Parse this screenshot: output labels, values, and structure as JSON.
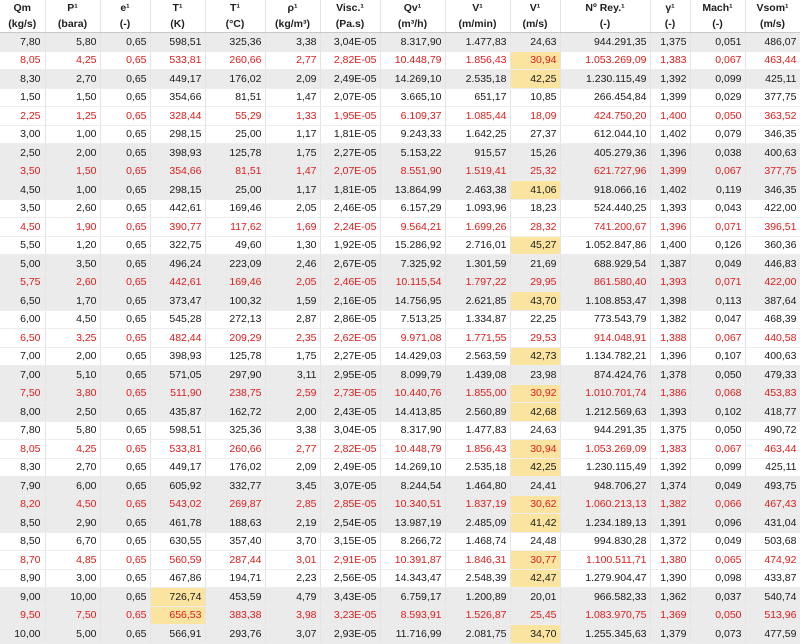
{
  "header": {
    "names": [
      "Qm",
      "P¹",
      "e¹",
      "T¹",
      "T¹",
      "ρ¹",
      "Visc.¹",
      "Qv¹",
      "V¹",
      "V¹",
      "Nº Rey.¹",
      "γ¹",
      "Mach¹",
      "Vsom¹"
    ],
    "units": [
      "(kg/s)",
      "(bara)",
      "(-)",
      "(K)",
      "(°C)",
      "(kg/m³)",
      "(Pa.s)",
      "(m³/h)",
      "(m/min)",
      "(m/s)",
      "(-)",
      "(-)",
      "(-)",
      "(m/s)"
    ]
  },
  "style": {
    "red_text": "#e01b1b",
    "black_text": "#1a1a1a",
    "band_grey": "#ebebeb",
    "highlight_yellow": "#fbe4a0"
  },
  "rows": [
    {
      "c": [
        "7,80",
        "5,80",
        "0,65",
        "598,51",
        "325,36",
        "3,38",
        "3,04E-05",
        "8.317,90",
        "1.477,83",
        "24,63",
        "944.291,35",
        "1,375",
        "0,051",
        "486,07"
      ],
      "red": false,
      "shade": true,
      "mark": []
    },
    {
      "c": [
        "8,05",
        "4,25",
        "0,65",
        "533,81",
        "260,66",
        "2,77",
        "2,82E-05",
        "10.448,79",
        "1.856,43",
        "30,94",
        "1.053.269,09",
        "1,383",
        "0,067",
        "463,44"
      ],
      "red": true,
      "shade": false,
      "mark": [
        9
      ]
    },
    {
      "c": [
        "8,30",
        "2,70",
        "0,65",
        "449,17",
        "176,02",
        "2,09",
        "2,49E-05",
        "14.269,10",
        "2.535,18",
        "42,25",
        "1.230.115,49",
        "1,392",
        "0,099",
        "425,11"
      ],
      "red": false,
      "shade": true,
      "mark": [
        9
      ]
    },
    {
      "c": [
        "1,50",
        "1,50",
        "0,65",
        "354,66",
        "81,51",
        "1,47",
        "2,07E-05",
        "3.665,10",
        "651,17",
        "10,85",
        "266.454,84",
        "1,399",
        "0,029",
        "377,75"
      ],
      "red": false,
      "shade": false,
      "mark": []
    },
    {
      "c": [
        "2,25",
        "1,25",
        "0,65",
        "328,44",
        "55,29",
        "1,33",
        "1,95E-05",
        "6.109,37",
        "1.085,44",
        "18,09",
        "424.750,20",
        "1,400",
        "0,050",
        "363,52"
      ],
      "red": true,
      "shade": false,
      "mark": []
    },
    {
      "c": [
        "3,00",
        "1,00",
        "0,65",
        "298,15",
        "25,00",
        "1,17",
        "1,81E-05",
        "9.243,33",
        "1.642,25",
        "27,37",
        "612.044,10",
        "1,402",
        "0,079",
        "346,35"
      ],
      "red": false,
      "shade": false,
      "mark": []
    },
    {
      "c": [
        "2,50",
        "2,00",
        "0,65",
        "398,93",
        "125,78",
        "1,75",
        "2,27E-05",
        "5.153,22",
        "915,57",
        "15,26",
        "405.279,36",
        "1,396",
        "0,038",
        "400,63"
      ],
      "red": false,
      "shade": true,
      "mark": []
    },
    {
      "c": [
        "3,50",
        "1,50",
        "0,65",
        "354,66",
        "81,51",
        "1,47",
        "2,07E-05",
        "8.551,90",
        "1.519,41",
        "25,32",
        "621.727,96",
        "1,399",
        "0,067",
        "377,75"
      ],
      "red": true,
      "shade": true,
      "mark": []
    },
    {
      "c": [
        "4,50",
        "1,00",
        "0,65",
        "298,15",
        "25,00",
        "1,17",
        "1,81E-05",
        "13.864,99",
        "2.463,38",
        "41,06",
        "918.066,16",
        "1,402",
        "0,119",
        "346,35"
      ],
      "red": false,
      "shade": true,
      "mark": [
        9
      ]
    },
    {
      "c": [
        "3,50",
        "2,60",
        "0,65",
        "442,61",
        "169,46",
        "2,05",
        "2,46E-05",
        "6.157,29",
        "1.093,96",
        "18,23",
        "524.440,25",
        "1,393",
        "0,043",
        "422,00"
      ],
      "red": false,
      "shade": false,
      "mark": []
    },
    {
      "c": [
        "4,50",
        "1,90",
        "0,65",
        "390,77",
        "117,62",
        "1,69",
        "2,24E-05",
        "9.564,21",
        "1.699,26",
        "28,32",
        "741.200,67",
        "1,396",
        "0,071",
        "396,51"
      ],
      "red": true,
      "shade": false,
      "mark": []
    },
    {
      "c": [
        "5,50",
        "1,20",
        "0,65",
        "322,75",
        "49,60",
        "1,30",
        "1,92E-05",
        "15.286,92",
        "2.716,01",
        "45,27",
        "1.052.847,86",
        "1,400",
        "0,126",
        "360,36"
      ],
      "red": false,
      "shade": false,
      "mark": [
        9
      ]
    },
    {
      "c": [
        "5,00",
        "3,50",
        "0,65",
        "496,24",
        "223,09",
        "2,46",
        "2,67E-05",
        "7.325,92",
        "1.301,59",
        "21,69",
        "688.929,54",
        "1,387",
        "0,049",
        "446,83"
      ],
      "red": false,
      "shade": true,
      "mark": []
    },
    {
      "c": [
        "5,75",
        "2,60",
        "0,65",
        "442,61",
        "169,46",
        "2,05",
        "2,46E-05",
        "10.115,54",
        "1.797,22",
        "29,95",
        "861.580,40",
        "1,393",
        "0,071",
        "422,00"
      ],
      "red": true,
      "shade": true,
      "mark": []
    },
    {
      "c": [
        "6,50",
        "1,70",
        "0,65",
        "373,47",
        "100,32",
        "1,59",
        "2,16E-05",
        "14.756,95",
        "2.621,85",
        "43,70",
        "1.108.853,47",
        "1,398",
        "0,113",
        "387,64"
      ],
      "red": false,
      "shade": true,
      "mark": [
        9
      ]
    },
    {
      "c": [
        "6,00",
        "4,50",
        "0,65",
        "545,28",
        "272,13",
        "2,87",
        "2,86E-05",
        "7.513,25",
        "1.334,87",
        "22,25",
        "773.543,79",
        "1,382",
        "0,047",
        "468,39"
      ],
      "red": false,
      "shade": false,
      "mark": []
    },
    {
      "c": [
        "6,50",
        "3,25",
        "0,65",
        "482,44",
        "209,29",
        "2,35",
        "2,62E-05",
        "9.971,08",
        "1.771,55",
        "29,53",
        "914.048,91",
        "1,388",
        "0,067",
        "440,58"
      ],
      "red": true,
      "shade": false,
      "mark": []
    },
    {
      "c": [
        "7,00",
        "2,00",
        "0,65",
        "398,93",
        "125,78",
        "1,75",
        "2,27E-05",
        "14.429,03",
        "2.563,59",
        "42,73",
        "1.134.782,21",
        "1,396",
        "0,107",
        "400,63"
      ],
      "red": false,
      "shade": false,
      "mark": [
        9
      ]
    },
    {
      "c": [
        "7,00",
        "5,10",
        "0,65",
        "571,05",
        "297,90",
        "3,11",
        "2,95E-05",
        "8.099,79",
        "1.439,08",
        "23,98",
        "874.424,76",
        "1,378",
        "0,050",
        "479,33"
      ],
      "red": false,
      "shade": true,
      "mark": []
    },
    {
      "c": [
        "7,50",
        "3,80",
        "0,65",
        "511,90",
        "238,75",
        "2,59",
        "2,73E-05",
        "10.440,76",
        "1.855,00",
        "30,92",
        "1.010.701,74",
        "1,386",
        "0,068",
        "453,83"
      ],
      "red": true,
      "shade": true,
      "mark": [
        9
      ]
    },
    {
      "c": [
        "8,00",
        "2,50",
        "0,65",
        "435,87",
        "162,72",
        "2,00",
        "2,43E-05",
        "14.413,85",
        "2.560,89",
        "42,68",
        "1.212.569,63",
        "1,393",
        "0,102",
        "418,77"
      ],
      "red": false,
      "shade": true,
      "mark": [
        9
      ]
    },
    {
      "c": [
        "7,80",
        "5,80",
        "0,65",
        "598,51",
        "325,36",
        "3,38",
        "3,04E-05",
        "8.317,90",
        "1.477,83",
        "24,63",
        "944.291,35",
        "1,375",
        "0,050",
        "490,72"
      ],
      "red": false,
      "shade": false,
      "mark": []
    },
    {
      "c": [
        "8,05",
        "4,25",
        "0,65",
        "533,81",
        "260,66",
        "2,77",
        "2,82E-05",
        "10.448,79",
        "1.856,43",
        "30,94",
        "1.053.269,09",
        "1,383",
        "0,067",
        "463,44"
      ],
      "red": true,
      "shade": false,
      "mark": [
        9
      ]
    },
    {
      "c": [
        "8,30",
        "2,70",
        "0,65",
        "449,17",
        "176,02",
        "2,09",
        "2,49E-05",
        "14.269,10",
        "2.535,18",
        "42,25",
        "1.230.115,49",
        "1,392",
        "0,099",
        "425,11"
      ],
      "red": false,
      "shade": false,
      "mark": [
        9
      ]
    },
    {
      "c": [
        "7,90",
        "6,00",
        "0,65",
        "605,92",
        "332,77",
        "3,45",
        "3,07E-05",
        "8.244,54",
        "1.464,80",
        "24,41",
        "948.706,27",
        "1,374",
        "0,049",
        "493,75"
      ],
      "red": false,
      "shade": true,
      "mark": []
    },
    {
      "c": [
        "8,20",
        "4,50",
        "0,65",
        "543,02",
        "269,87",
        "2,85",
        "2,85E-05",
        "10.340,51",
        "1.837,19",
        "30,62",
        "1.060.213,13",
        "1,382",
        "0,066",
        "467,43"
      ],
      "red": true,
      "shade": true,
      "mark": [
        9
      ]
    },
    {
      "c": [
        "8,50",
        "2,90",
        "0,65",
        "461,78",
        "188,63",
        "2,19",
        "2,54E-05",
        "13.987,19",
        "2.485,09",
        "41,42",
        "1.234.189,13",
        "1,391",
        "0,096",
        "431,04"
      ],
      "red": false,
      "shade": true,
      "mark": [
        9
      ]
    },
    {
      "c": [
        "8,50",
        "6,70",
        "0,65",
        "630,55",
        "357,40",
        "3,70",
        "3,15E-05",
        "8.266,72",
        "1.468,74",
        "24,48",
        "994.830,28",
        "1,372",
        "0,049",
        "503,68"
      ],
      "red": false,
      "shade": false,
      "mark": []
    },
    {
      "c": [
        "8,70",
        "4,85",
        "0,65",
        "560,59",
        "287,44",
        "3,01",
        "2,91E-05",
        "10.391,87",
        "1.846,31",
        "30,77",
        "1.100.511,71",
        "1,380",
        "0,065",
        "474,92"
      ],
      "red": true,
      "shade": false,
      "mark": [
        9
      ]
    },
    {
      "c": [
        "8,90",
        "3,00",
        "0,65",
        "467,86",
        "194,71",
        "2,23",
        "2,56E-05",
        "14.343,47",
        "2.548,39",
        "42,47",
        "1.279.904,47",
        "1,390",
        "0,098",
        "433,87"
      ],
      "red": false,
      "shade": false,
      "mark": [
        9
      ]
    },
    {
      "c": [
        "9,00",
        "10,00",
        "0,65",
        "726,74",
        "453,59",
        "4,79",
        "3,43E-05",
        "6.759,17",
        "1.200,89",
        "20,01",
        "966.582,33",
        "1,362",
        "0,037",
        "540,74"
      ],
      "red": false,
      "shade": true,
      "mark": [
        3
      ]
    },
    {
      "c": [
        "9,50",
        "7,50",
        "0,65",
        "656,53",
        "383,38",
        "3,98",
        "3,23E-05",
        "8.593,91",
        "1.526,87",
        "25,45",
        "1.083.970,75",
        "1,369",
        "0,050",
        "513,96"
      ],
      "red": true,
      "shade": true,
      "mark": [
        3
      ]
    },
    {
      "c": [
        "10,00",
        "5,00",
        "0,65",
        "566,91",
        "293,76",
        "3,07",
        "2,93E-05",
        "11.716,99",
        "2.081,75",
        "34,70",
        "1.255.345,63",
        "1,379",
        "0,073",
        "477,59"
      ],
      "red": false,
      "shade": true,
      "mark": [
        9
      ]
    }
  ]
}
